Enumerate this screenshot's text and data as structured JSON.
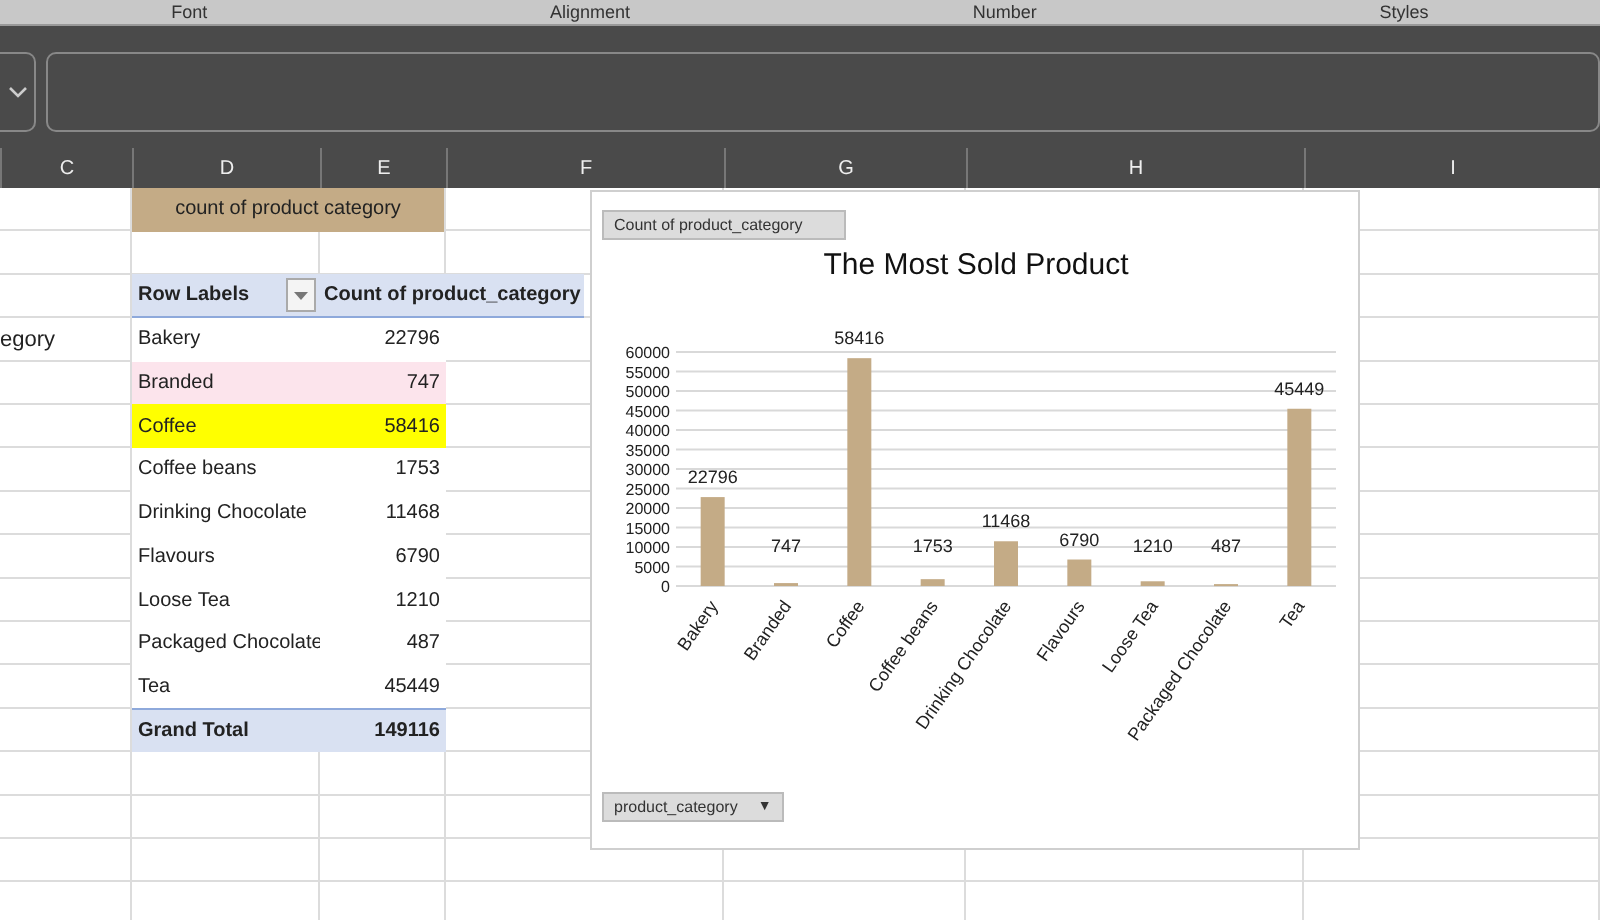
{
  "ribbon_groups": [
    "Font",
    "Alignment",
    "Number",
    "Styles"
  ],
  "columns": [
    "C",
    "D",
    "E",
    "F",
    "G",
    "H",
    "I"
  ],
  "column_c_text": "egory",
  "pivot": {
    "title": "count of product category",
    "row_header": "Row Labels",
    "value_header": "Count of product_category",
    "rows": [
      {
        "label": "Bakery",
        "value": "22796",
        "color": "#ffffff"
      },
      {
        "label": "Branded",
        "value": "747",
        "color": "#fce4ec"
      },
      {
        "label": "Coffee",
        "value": "58416",
        "color": "#ffff00"
      },
      {
        "label": "Coffee beans",
        "value": "1753",
        "color": "#ffffff"
      },
      {
        "label": "Drinking Chocolate",
        "value": "11468",
        "color": "#ffffff"
      },
      {
        "label": "Flavours",
        "value": "6790",
        "color": "#ffffff"
      },
      {
        "label": "Loose Tea",
        "value": "1210",
        "color": "#ffffff"
      },
      {
        "label": "Packaged Chocolate",
        "value": "487",
        "color": "#ffffff"
      },
      {
        "label": "Tea",
        "value": "45449",
        "color": "#ffffff"
      }
    ],
    "total_label": "Grand Total",
    "total_value": "149116"
  },
  "chart": {
    "axis_field_button": "product_category",
    "axis_field_arrow": "▼",
    "chart_data": {
      "type": "bar",
      "title": "The Most Sold  Product",
      "categories": [
        "Bakery",
        "Branded",
        "Coffee",
        "Coffee beans",
        "Drinking Chocolate",
        "Flavours",
        "Loose Tea",
        "Packaged Chocolate",
        "Tea"
      ],
      "series": [
        {
          "name": "Count of product_category",
          "color": "#c4ab86",
          "values": [
            22796,
            747,
            58416,
            1753,
            11468,
            6790,
            1210,
            487,
            45449
          ]
        }
      ],
      "ylim": [
        0,
        60000
      ],
      "yticks": [
        0,
        5000,
        10000,
        15000,
        20000,
        25000,
        30000,
        35000,
        40000,
        45000,
        50000,
        55000,
        60000
      ],
      "data_labels": true,
      "grid": true
    }
  }
}
